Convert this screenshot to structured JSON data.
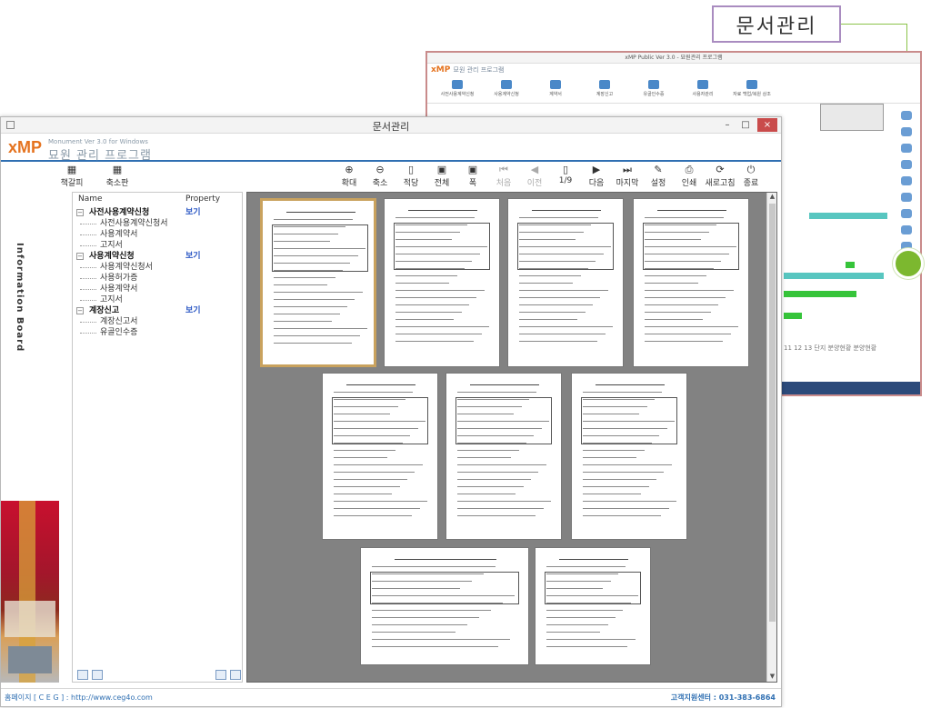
{
  "callout": {
    "label": "문서관리"
  },
  "background_window": {
    "title": "xMP Public Ver 3.0 - 묘원관리 프로그램",
    "brand": "xMP",
    "brand_sub": "묘원 관리 프로그램",
    "toolbar": [
      "사전사용계약신청",
      "사용계약신청",
      "계약서",
      "계장신고",
      "유골인수증",
      "사용자관리",
      "자료 백업/복원 상조"
    ],
    "pager": "11  12  13  단지  분양현황  분양현황"
  },
  "window": {
    "title": "문서관리",
    "brand_logo": "xMP",
    "brand_sub1": "Monument Ver 3.0 for Windows",
    "brand_sub2": "묘원 관리 프로그램",
    "minimize": "–",
    "maximize": "□",
    "close": "×"
  },
  "side_label": "Information Board",
  "left_toolbar": [
    {
      "label": "책갈피",
      "icon": "bookmark-icon",
      "glyph": "▦"
    },
    {
      "label": "축소판",
      "icon": "thumbnail-icon",
      "glyph": "▦"
    }
  ],
  "right_toolbar": [
    {
      "label": "확대",
      "icon": "zoom-in-icon",
      "glyph": "⊕",
      "enabled": true
    },
    {
      "label": "축소",
      "icon": "zoom-out-icon",
      "glyph": "⊖",
      "enabled": true
    },
    {
      "label": "적당",
      "icon": "fit-page-icon",
      "glyph": "▯",
      "enabled": true
    },
    {
      "label": "전체",
      "icon": "full-page-icon",
      "glyph": "▣",
      "enabled": true
    },
    {
      "label": "폭",
      "icon": "fit-width-icon",
      "glyph": "▣",
      "enabled": true
    },
    {
      "label": "처음",
      "icon": "first-page-icon",
      "glyph": "⏮",
      "enabled": false
    },
    {
      "label": "이전",
      "icon": "previous-page-icon",
      "glyph": "◀",
      "enabled": false
    },
    {
      "label": "1/9",
      "icon": "page-number-icon",
      "glyph": "▯",
      "enabled": true
    },
    {
      "label": "다음",
      "icon": "next-page-icon",
      "glyph": "▶",
      "enabled": true
    },
    {
      "label": "마지막",
      "icon": "last-page-icon",
      "glyph": "⏭",
      "enabled": true
    },
    {
      "label": "설정",
      "icon": "settings-icon",
      "glyph": "✎",
      "enabled": true
    },
    {
      "label": "인쇄",
      "icon": "print-icon",
      "glyph": "⎙",
      "enabled": true
    },
    {
      "label": "새로고침",
      "icon": "refresh-icon",
      "glyph": "⟳",
      "enabled": true
    },
    {
      "label": "종료",
      "icon": "exit-icon",
      "glyph": "⏻",
      "enabled": true
    }
  ],
  "tree": {
    "header_name": "Name",
    "header_property": "Property",
    "groups": [
      {
        "label": "사전사용계약신청",
        "property": "보기",
        "children": [
          "사전사용계약신청서",
          "사용계약서",
          "고지서"
        ]
      },
      {
        "label": "사용계약신청",
        "property": "보기",
        "children": [
          "사용계약신청서",
          "사용허가증",
          "사용계약서",
          "고지서"
        ]
      },
      {
        "label": "계장신고",
        "property": "보기",
        "children": [
          "계장신고서",
          "유골인수증"
        ]
      }
    ]
  },
  "status": {
    "left": "홈페이지 [ C E G ] : http://www.ceg4o.com",
    "right": "고객지원센터 : 031-383-6864"
  }
}
